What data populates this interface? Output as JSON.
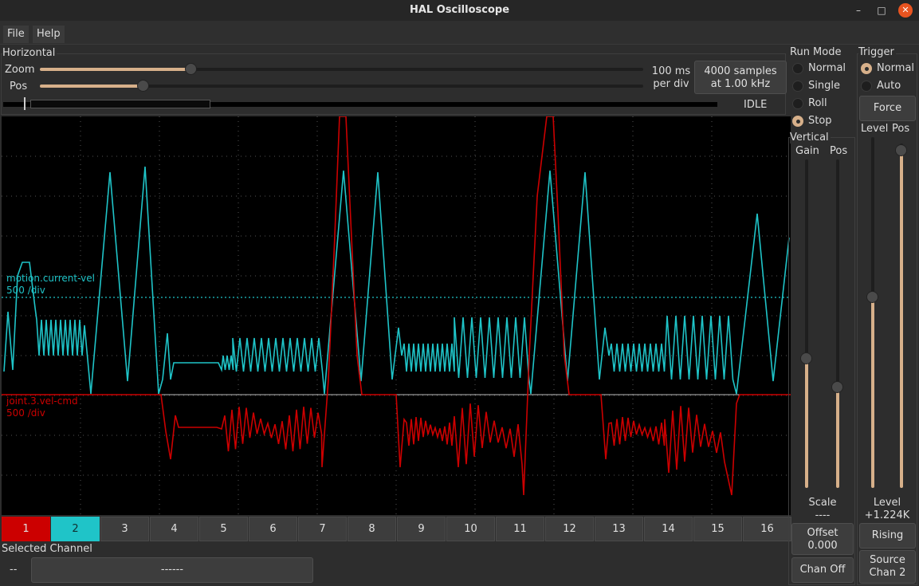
{
  "window": {
    "title": "HAL Oscilloscope",
    "minimize": "–",
    "maximize": "□",
    "close": "✕"
  },
  "menu": {
    "file": "File",
    "help": "Help"
  },
  "horizontal": {
    "label": "Horizontal",
    "zoom_label": "Zoom",
    "pos_label": "Pos",
    "zoom_value": 0.25,
    "pos_value": 0.17,
    "time_per_div": "100 ms",
    "time_per_div_unit": "per div",
    "samples": "4000 samples",
    "rate": "at 1.00 kHz",
    "status": "IDLE"
  },
  "run_mode": {
    "label": "Run Mode",
    "options": [
      "Normal",
      "Single",
      "Roll",
      "Stop"
    ],
    "selected": "Stop"
  },
  "trigger": {
    "label": "Trigger",
    "options": [
      "Normal",
      "Auto"
    ],
    "selected": "Normal",
    "force_label": "Force",
    "level_label": "Level",
    "pos_label": "Pos",
    "level_readout_label": "Level",
    "level_readout": "+1.224K",
    "edge": "Rising",
    "source_label": "Source",
    "source_chan": "Chan  2"
  },
  "vertical": {
    "label": "Vertical",
    "gain_label": "Gain",
    "pos_label": "Pos",
    "scale_label": "Scale",
    "scale_value": "----",
    "offset_label": "Offset",
    "offset_value": "0.000",
    "chan_off": "Chan Off"
  },
  "traces": {
    "ch2_name": "motion.current-vel",
    "ch2_scale": "500 /div",
    "ch1_name": "joint.3.vel-cmd",
    "ch1_scale": "500 /div"
  },
  "channels": [
    "1",
    "2",
    "3",
    "4",
    "5",
    "6",
    "7",
    "8",
    "9",
    "10",
    "11",
    "12",
    "13",
    "14",
    "15",
    "16"
  ],
  "selected_channel": {
    "label": "Selected Channel",
    "id": "--",
    "name": "------"
  },
  "colors": {
    "ch1": "#cc0000",
    "ch2": "#1fc4c8",
    "accent": "#d7b08a",
    "scope_bg": "#000000"
  }
}
